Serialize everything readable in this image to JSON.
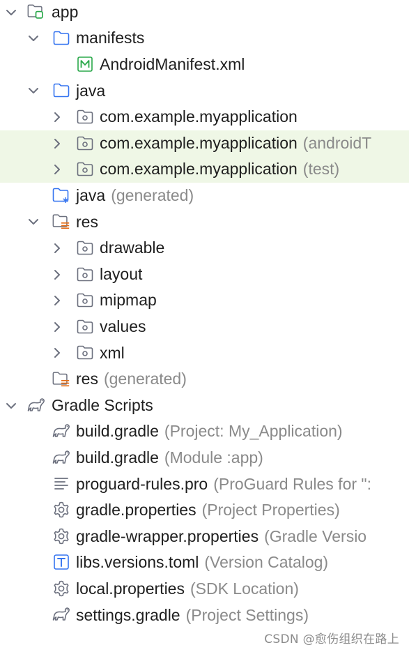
{
  "tree": [
    {
      "level": 0,
      "chevron": "down",
      "icon": "app-module-icon",
      "name": "app",
      "hint": ""
    },
    {
      "level": 1,
      "chevron": "down",
      "icon": "folder-icon",
      "name": "manifests",
      "hint": ""
    },
    {
      "level": 2,
      "chevron": "none",
      "icon": "manifest-file-icon",
      "name": "AndroidManifest.xml",
      "hint": ""
    },
    {
      "level": 1,
      "chevron": "down",
      "icon": "folder-icon",
      "name": "java",
      "hint": ""
    },
    {
      "level": 2,
      "chevron": "right",
      "icon": "package-icon",
      "name": "com.example.myapplication",
      "hint": ""
    },
    {
      "level": 2,
      "chevron": "right",
      "icon": "package-icon",
      "name": "com.example.myapplication",
      "hint": "(androidT",
      "highlight": true
    },
    {
      "level": 2,
      "chevron": "right",
      "icon": "package-icon",
      "name": "com.example.myapplication",
      "hint": "(test)",
      "highlight": true
    },
    {
      "level": 1,
      "chevron": "none",
      "icon": "generated-folder-icon",
      "name": "java",
      "hint": "(generated)"
    },
    {
      "level": 1,
      "chevron": "down",
      "icon": "res-folder-icon",
      "name": "res",
      "hint": ""
    },
    {
      "level": 2,
      "chevron": "right",
      "icon": "package-icon",
      "name": "drawable",
      "hint": ""
    },
    {
      "level": 2,
      "chevron": "right",
      "icon": "package-icon",
      "name": "layout",
      "hint": ""
    },
    {
      "level": 2,
      "chevron": "right",
      "icon": "package-icon",
      "name": "mipmap",
      "hint": ""
    },
    {
      "level": 2,
      "chevron": "right",
      "icon": "package-icon",
      "name": "values",
      "hint": ""
    },
    {
      "level": 2,
      "chevron": "right",
      "icon": "package-icon",
      "name": "xml",
      "hint": ""
    },
    {
      "level": 1,
      "chevron": "none",
      "icon": "res-folder-icon",
      "name": "res",
      "hint": "(generated)"
    },
    {
      "level": 0,
      "chevron": "down",
      "icon": "gradle-icon",
      "name": "Gradle Scripts",
      "hint": ""
    },
    {
      "level": 1,
      "chevron": "none",
      "icon": "gradle-icon",
      "name": "build.gradle",
      "hint": "(Project: My_Application)"
    },
    {
      "level": 1,
      "chevron": "none",
      "icon": "gradle-icon",
      "name": "build.gradle",
      "hint": "(Module :app)"
    },
    {
      "level": 1,
      "chevron": "none",
      "icon": "text-file-icon",
      "name": "proguard-rules.pro",
      "hint": "(ProGuard Rules for \":"
    },
    {
      "level": 1,
      "chevron": "none",
      "icon": "gear-icon",
      "name": "gradle.properties",
      "hint": "(Project Properties)"
    },
    {
      "level": 1,
      "chevron": "none",
      "icon": "gear-icon",
      "name": "gradle-wrapper.properties",
      "hint": "(Gradle Versio"
    },
    {
      "level": 1,
      "chevron": "none",
      "icon": "toml-file-icon",
      "name": "libs.versions.toml",
      "hint": "(Version Catalog)"
    },
    {
      "level": 1,
      "chevron": "none",
      "icon": "gear-icon",
      "name": "local.properties",
      "hint": "(SDK Location)"
    },
    {
      "level": 1,
      "chevron": "none",
      "icon": "gradle-icon",
      "name": "settings.gradle",
      "hint": "(Project Settings)"
    }
  ],
  "watermark": "CSDN @愈伤组织在路上",
  "colors": {
    "highlight": "#eff7e6",
    "hint": "#8a8a8a",
    "folder_blue": "#3574f0",
    "android_green": "#2aa84a",
    "res_orange": "#e66d17",
    "icon_gray": "#6c707e"
  }
}
